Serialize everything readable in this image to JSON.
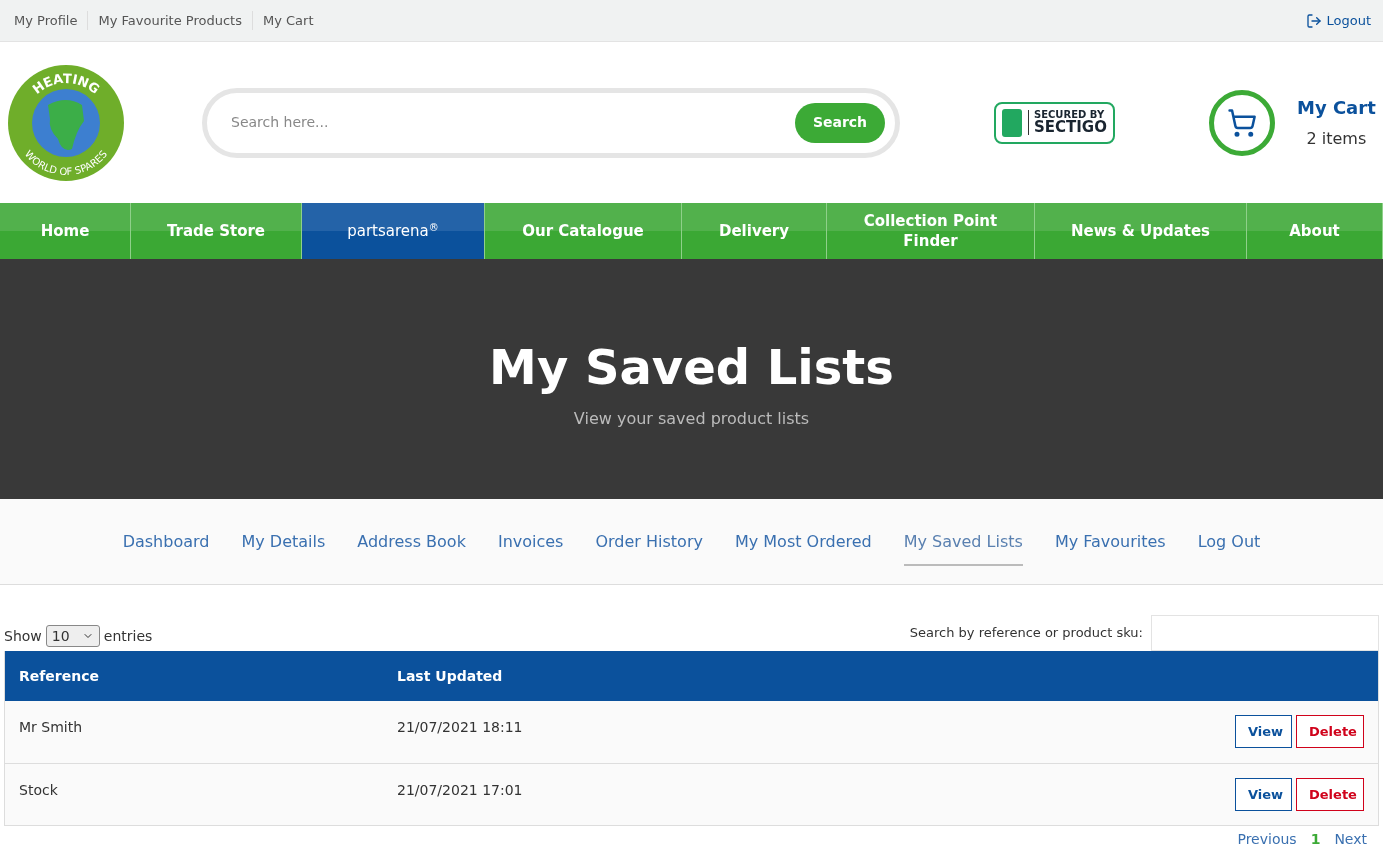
{
  "top_links": [
    "My Profile",
    "My Favourite Products",
    "My Cart"
  ],
  "logout": "Logout",
  "logo": {
    "top_text": "HEATING",
    "bottom_text": "WORLD OF SPARES"
  },
  "search": {
    "placeholder": "Search here...",
    "button": "Search"
  },
  "badge": {
    "line_1": "SECURED BY",
    "line_2": "SECTIGO"
  },
  "cart": {
    "title": "My Cart",
    "count": "2 items"
  },
  "nav": [
    {
      "label": "Home",
      "selected": false
    },
    {
      "label": "Trade Store",
      "selected": false
    },
    {
      "label": "partsarena",
      "selected": true,
      "sup": "®"
    },
    {
      "label": "Our Catalogue",
      "selected": false
    },
    {
      "label": "Delivery",
      "selected": false
    },
    {
      "label": "Collection Point Finder",
      "selected": false
    },
    {
      "label": "News & Updates",
      "selected": false
    },
    {
      "label": "About",
      "selected": false
    }
  ],
  "hero": {
    "title": "My Saved Lists",
    "subtitle": "View your saved product lists"
  },
  "account_tabs": [
    {
      "label": "Dashboard",
      "selected": false
    },
    {
      "label": "My Details",
      "selected": false
    },
    {
      "label": "Address Book",
      "selected": false
    },
    {
      "label": "Invoices",
      "selected": false
    },
    {
      "label": "Order History",
      "selected": false
    },
    {
      "label": "My Most Ordered",
      "selected": false
    },
    {
      "label": "My Saved Lists",
      "selected": true
    },
    {
      "label": "My Favourites",
      "selected": false
    },
    {
      "label": "Log Out",
      "selected": false
    }
  ],
  "table_controls": {
    "show_label": "Show",
    "page_size": "10",
    "entries_label": "entries",
    "search_label": "Search by reference or product sku:"
  },
  "table": {
    "columns": [
      "Reference",
      "Last Updated"
    ],
    "rows": [
      {
        "reference": "Mr Smith",
        "last_updated": "21/07/2021 18:11",
        "actions": [
          "View",
          "Delete"
        ]
      },
      {
        "reference": "Stock",
        "last_updated": "21/07/2021 17:01",
        "actions": [
          "View",
          "Delete"
        ]
      }
    ]
  },
  "pagination": [
    {
      "label": "Previous",
      "selected": false
    },
    {
      "label": "1",
      "selected": true
    },
    {
      "label": "Next",
      "selected": false
    }
  ]
}
